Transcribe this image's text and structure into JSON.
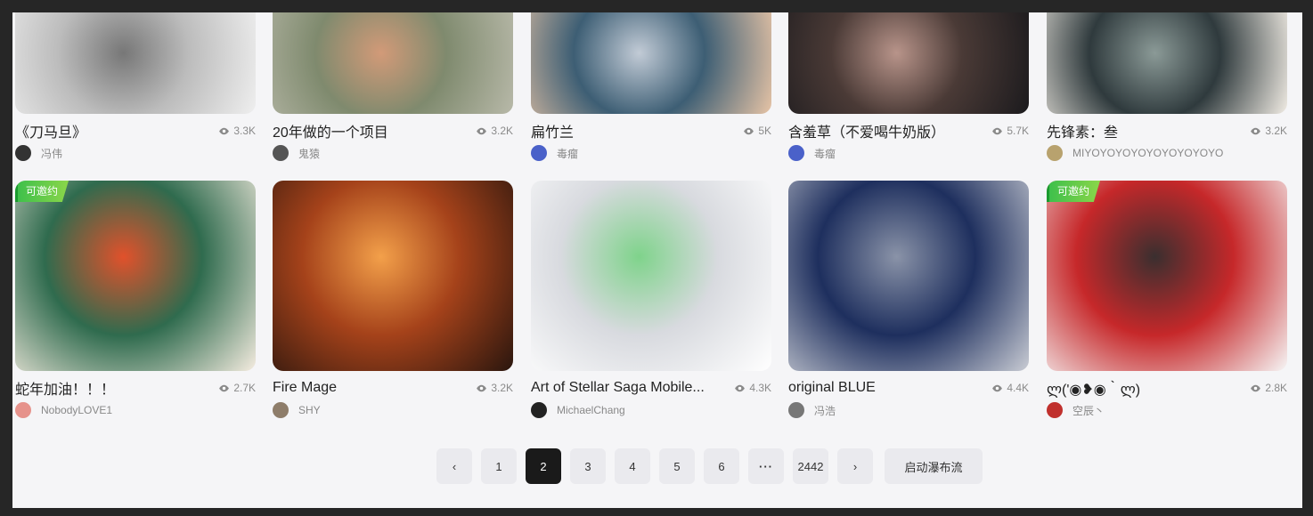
{
  "row1": [
    {
      "title": "《刀马旦》",
      "views": "3.3K",
      "author": "冯伟",
      "colors": [
        "#efefef",
        "#bcbcbc",
        "#777"
      ],
      "avatar": "#333"
    },
    {
      "title": "20年做的一个项目",
      "views": "3.2K",
      "author": "鬼猿",
      "colors": [
        "#b8b9a9",
        "#7f8a6e",
        "#d29a78"
      ],
      "avatar": "#555"
    },
    {
      "title": "扁竹兰",
      "views": "5K",
      "author": "毒瘤",
      "colors": [
        "#e7c4a6",
        "#3d5e74",
        "#c2cbd6"
      ],
      "avatar": "#4a61c9"
    },
    {
      "title": "含羞草（不爱喝牛奶版）",
      "views": "5.7K",
      "author": "毒瘤",
      "colors": [
        "#1b1a1d",
        "#4a3a36",
        "#b8948a"
      ],
      "avatar": "#4a61c9"
    },
    {
      "title": "先锋素：叁",
      "views": "3.2K",
      "author": "MIYOYOYOYOYOYOYOYOYO",
      "colors": [
        "#f1ece4",
        "#2f3a3d",
        "#8b9a97"
      ],
      "avatar": "#b8a26e"
    }
  ],
  "row2": [
    {
      "title": "蛇年加油！！！",
      "views": "2.7K",
      "author": "NobodyLOVE1",
      "badge": "可邀约",
      "colors": [
        "#f5ece0",
        "#2f6b4e",
        "#e1512b"
      ],
      "avatar": "#e6928b"
    },
    {
      "title": "Fire Mage",
      "views": "3.2K",
      "author": "SHY",
      "colors": [
        "#2a160e",
        "#a5421a",
        "#f3a04a"
      ],
      "avatar": "#8e7d6a"
    },
    {
      "title": "Art of Stellar Saga Mobile...",
      "views": "4.3K",
      "author": "MichaelChang",
      "colors": [
        "#ffffff",
        "#d8dadf",
        "#7fd38b"
      ],
      "avatar": "#222"
    },
    {
      "title": "original BLUE",
      "views": "4.4K",
      "author": "冯浩",
      "colors": [
        "#c9ccd4",
        "#1e2f5e",
        "#8a93a8"
      ],
      "avatar": "#777"
    },
    {
      "title": "ლ(ʹ◉❥◉｀ლ)",
      "views": "2.8K",
      "author": "空辰丶",
      "badge": "可邀约",
      "colors": [
        "#f6f6f6",
        "#c6282a",
        "#3a2f2f"
      ],
      "avatar": "#c0302d"
    }
  ],
  "pagination": {
    "prev": "‹",
    "pages": [
      "1",
      "2",
      "3",
      "4",
      "5",
      "6",
      "···",
      "2442"
    ],
    "active": "2",
    "next": "›",
    "waterfall": "启动瀑布流"
  }
}
